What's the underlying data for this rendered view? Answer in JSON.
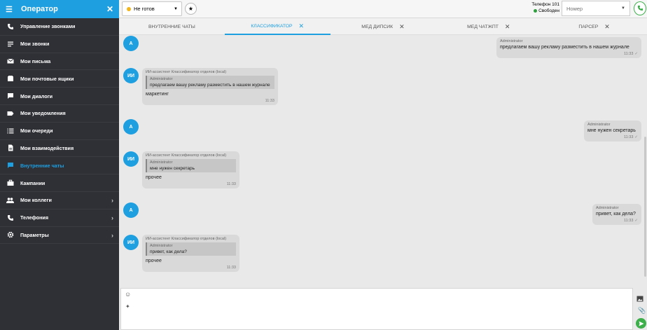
{
  "sidebar": {
    "title": "Оператор",
    "items": [
      {
        "label": "Управление звонками",
        "icon": "phone-icon"
      },
      {
        "label": "Мои звонки",
        "icon": "list-icon"
      },
      {
        "label": "Мои письма",
        "icon": "mail-icon"
      },
      {
        "label": "Мои почтовые ящики",
        "icon": "mailbox-icon"
      },
      {
        "label": "Мои диалоги",
        "icon": "chat-icon"
      },
      {
        "label": "Мои уведомления",
        "icon": "label-icon"
      },
      {
        "label": "Мои очереди",
        "icon": "queue-icon"
      },
      {
        "label": "Мои взаимодействия",
        "icon": "document-icon"
      },
      {
        "label": "Внутренние чаты",
        "icon": "chat-bubble-icon",
        "active": true
      },
      {
        "label": "Кампании",
        "icon": "briefcase-icon"
      },
      {
        "label": "Мои коллеги",
        "icon": "people-icon"
      },
      {
        "label": "Телефония",
        "icon": "phone-icon"
      },
      {
        "label": "Параметры",
        "icon": "gear-icon"
      }
    ]
  },
  "topbar": {
    "status": "Не готов",
    "phone_label": "Телефон 101",
    "phone_status": "Свободен",
    "number_placeholder": "Номер"
  },
  "tabs": [
    {
      "label": "ВНУТРЕННИЕ ЧАТЫ",
      "closable": false
    },
    {
      "label": "КЛАССИФИКАТОР",
      "closable": true,
      "active": true
    },
    {
      "label": "МЕД ДИПСИК",
      "closable": true
    },
    {
      "label": "МЕД ЧАТЖПТ",
      "closable": true
    },
    {
      "label": "ПАРСЕР",
      "closable": true
    }
  ],
  "messages": [
    {
      "avatar": "А"
    },
    {
      "author": "Administrator",
      "text": "предлагаем вашу рекламу разместить в нашем журнале",
      "time": "11:33"
    },
    {
      "avatar": "ИИ",
      "author": "ИИ-ассистент Классификатор отделов (local)",
      "quote_author": "Administrator",
      "quote_text": "предлагаем вашу рекламу разместить в нашем журнале",
      "text": "маркетинг",
      "time": "11:33"
    },
    {
      "avatar": "А"
    },
    {
      "author": "Administrator",
      "text": "мне нужен секретарь",
      "time": "11:33"
    },
    {
      "avatar": "ИИ",
      "author": "ИИ-ассистент Классификатор отделов (local)",
      "quote_author": "Administrator",
      "quote_text": "мне нужен секретарь",
      "text": "прочее",
      "time": "11:33"
    },
    {
      "avatar": "А"
    },
    {
      "author": "Administrator",
      "text": "привет, как дела?",
      "time": "11:33"
    },
    {
      "avatar": "ИИ",
      "author": "ИИ-ассистент Классификатор отделов (local)",
      "quote_author": "Administrator",
      "quote_text": "привет, как дела?",
      "text": "прочее",
      "time": "11:33"
    }
  ],
  "colors": {
    "accent": "#1e9fe0",
    "sidebar": "#2f3036",
    "status_not_ready": "#f2b51c",
    "status_free": "#2e9e3f",
    "send": "#3caf4a"
  }
}
